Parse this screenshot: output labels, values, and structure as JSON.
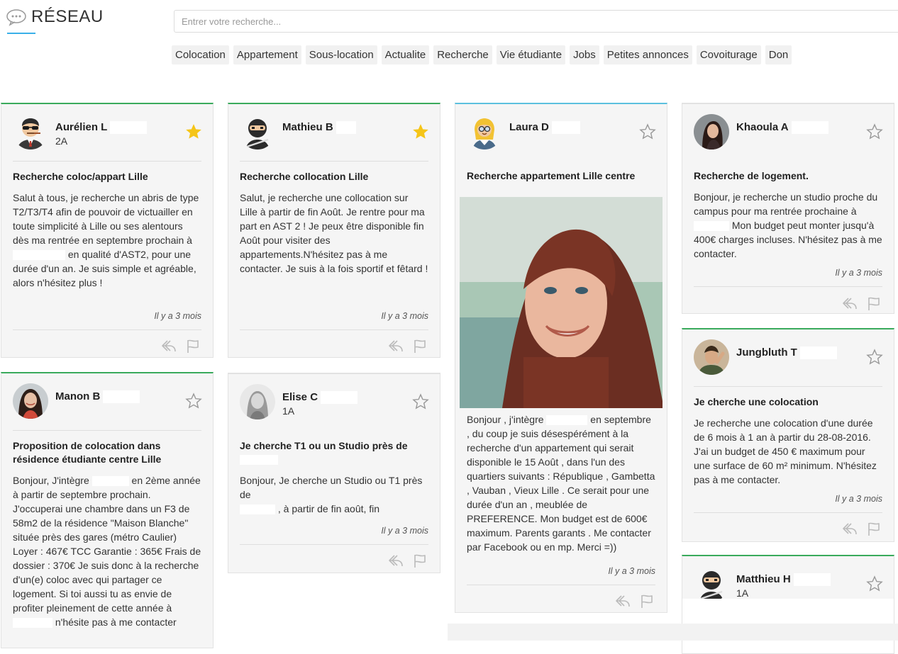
{
  "header": {
    "brand": "RÉSEAU",
    "search_placeholder": "Entrer votre recherche...",
    "tags": [
      "Colocation",
      "Appartement",
      "Sous-location",
      "Actualite",
      "Recherche",
      "Vie étudiante",
      "Jobs",
      "Petites annonces",
      "Covoiturage",
      "Don"
    ]
  },
  "colors": {
    "accent_green": "#3aaa5c",
    "accent_blue": "#5bc0de",
    "star_filled": "#f5c518",
    "star_empty": "#999999"
  },
  "posts": [
    {
      "name": "Aurélien L",
      "level": "2A",
      "starred": true,
      "avatar": "cool-guy-avatar-icon",
      "title": "Recherche coloc/appart Lille",
      "body_a": "Salut à tous, je recherche un abris de type T2/T3/T4 afin de pouvoir de victuailler en toute simplicité à Lille ou ses alentours dès ma rentrée en septembre prochain à",
      "body_b": " en qualité d'AST2, pour une durée d'un an. Je suis simple et agréable, alors n'hésitez plus !",
      "time": "Il y a 3 mois"
    },
    {
      "name": "Mathieu B",
      "level": "",
      "starred": true,
      "avatar": "ninja-avatar-icon",
      "title": "Recherche collocation Lille",
      "body": "Salut, je recherche une collocation sur Lille à partir de fin Août. Je rentre pour ma part en AST 2 ! Je peux être disponible fin Août pour visiter des appartements.N'hésitez pas à me contacter. Je suis à la fois sportif et fêtard !",
      "time": "Il y a 3 mois"
    },
    {
      "name": "Laura D",
      "level": "",
      "starred": false,
      "avatar": "blonde-avatar-icon",
      "title": "Recherche appartement Lille centre",
      "body_a": "Bonjour , j'intègre",
      "body_b": " en septembre , du coup je suis désespérément à la recherche d'un appartement qui serait disponible le 15 Août , dans l'un des quartiers suivants : République , Gambetta , Vauban , Vieux Lille . Ce serait pour une durée d'un an , meublée de PREFERENCE. Mon budget est de 600€ maximum. Parents garants . Me contacter par Facebook ou en mp. Merci =))",
      "time": "Il y a 3 mois"
    },
    {
      "name": "Khaoula A",
      "level": "",
      "starred": false,
      "avatar": "user-photo-avatar",
      "title": "Recherche de logement.",
      "body_a": "Bonjour, je recherche un studio proche du campus pour ma rentrée prochaine à",
      "body_b": " Mon budget peut monter jusqu'à 400€ charges incluses. N'hésitez pas à me contacter.",
      "time": "Il y a 3 mois"
    },
    {
      "name": "Manon B",
      "level": "",
      "starred": false,
      "avatar": "user-photo-avatar",
      "title": "Proposition de colocation dans résidence étudiante centre Lille",
      "body_a": "Bonjour, J'intègre",
      "body_b": " en 2ème année à partir de septembre prochain. J'occuperai une chambre dans un F3 de 58m2 de la résidence \"Maison Blanche\" située près des gares (métro Caulier) Loyer : 467€ TCC Garantie : 365€ Frais de dossier : 370€ Je suis donc à la recherche d'un(e) coloc avec qui partager ce logement. Si toi aussi tu as envie de profiter pleinement de cette année à",
      "body_c": " n'hésite pas à me contacter"
    },
    {
      "name": "Elise C",
      "level": "1A",
      "starred": false,
      "avatar": "user-photo-avatar",
      "title": "Je cherche T1 ou un Studio près de",
      "body_a": "Bonjour, Je cherche un Studio ou T1 près de",
      "body_b": " , à partir de fin août, fin septembre pour un budget maximum de",
      "time": "Il y a 3 mois"
    },
    {
      "name": "Jungbluth T",
      "level": "",
      "starred": false,
      "avatar": "user-photo-avatar",
      "title": "Je cherche une colocation",
      "body": "Je recherche une colocation d'une durée de 6 mois à 1 an à partir du 28-08-2016. J'ai un budget de 450 € maximum pour une surface de 60 m² minimum. N'hésitez pas à me contacter.",
      "time": "Il y a 3 mois"
    },
    {
      "name": "Matthieu H",
      "level": "1A",
      "starred": false,
      "avatar": "ninja-avatar-icon"
    }
  ]
}
